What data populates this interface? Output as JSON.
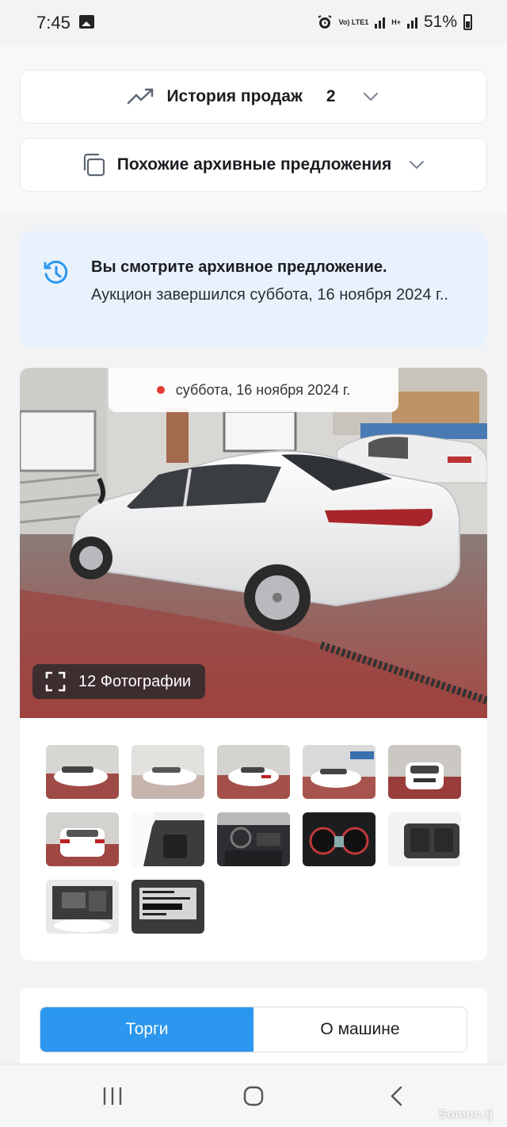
{
  "status_bar": {
    "time": "7:45",
    "volte_label": "Vo) LTE1",
    "network_label": "H+",
    "battery": "51%"
  },
  "sales_history": {
    "label": "История продаж",
    "count": "2",
    "icon": "trending-up-icon"
  },
  "similar_archive": {
    "label": "Похожие архивные предложения",
    "icon": "copy-icon"
  },
  "archive_notice": {
    "title": "Вы смотрите архивное предложение.",
    "body": "Аукцион завершился суббота, 16 ноября 2024 г..",
    "icon": "history-icon"
  },
  "gallery": {
    "date": "суббота, 16 ноября 2024 г.",
    "photo_count": "12 Фотографии",
    "thumbnails": [
      "rear-left view",
      "rear-left view",
      "rear view",
      "front-left view",
      "front view",
      "rear view",
      "driver door interior",
      "dashboard interior",
      "instrument cluster",
      "rear seats",
      "engine bay",
      "vin label"
    ]
  },
  "tabs": {
    "active": "Торги",
    "inactive": "О машине"
  },
  "watermark": "Somon.tj",
  "colors": {
    "accent": "#2b97ee",
    "notice_bg": "#e8f2fc",
    "live_dot": "#e53935"
  }
}
